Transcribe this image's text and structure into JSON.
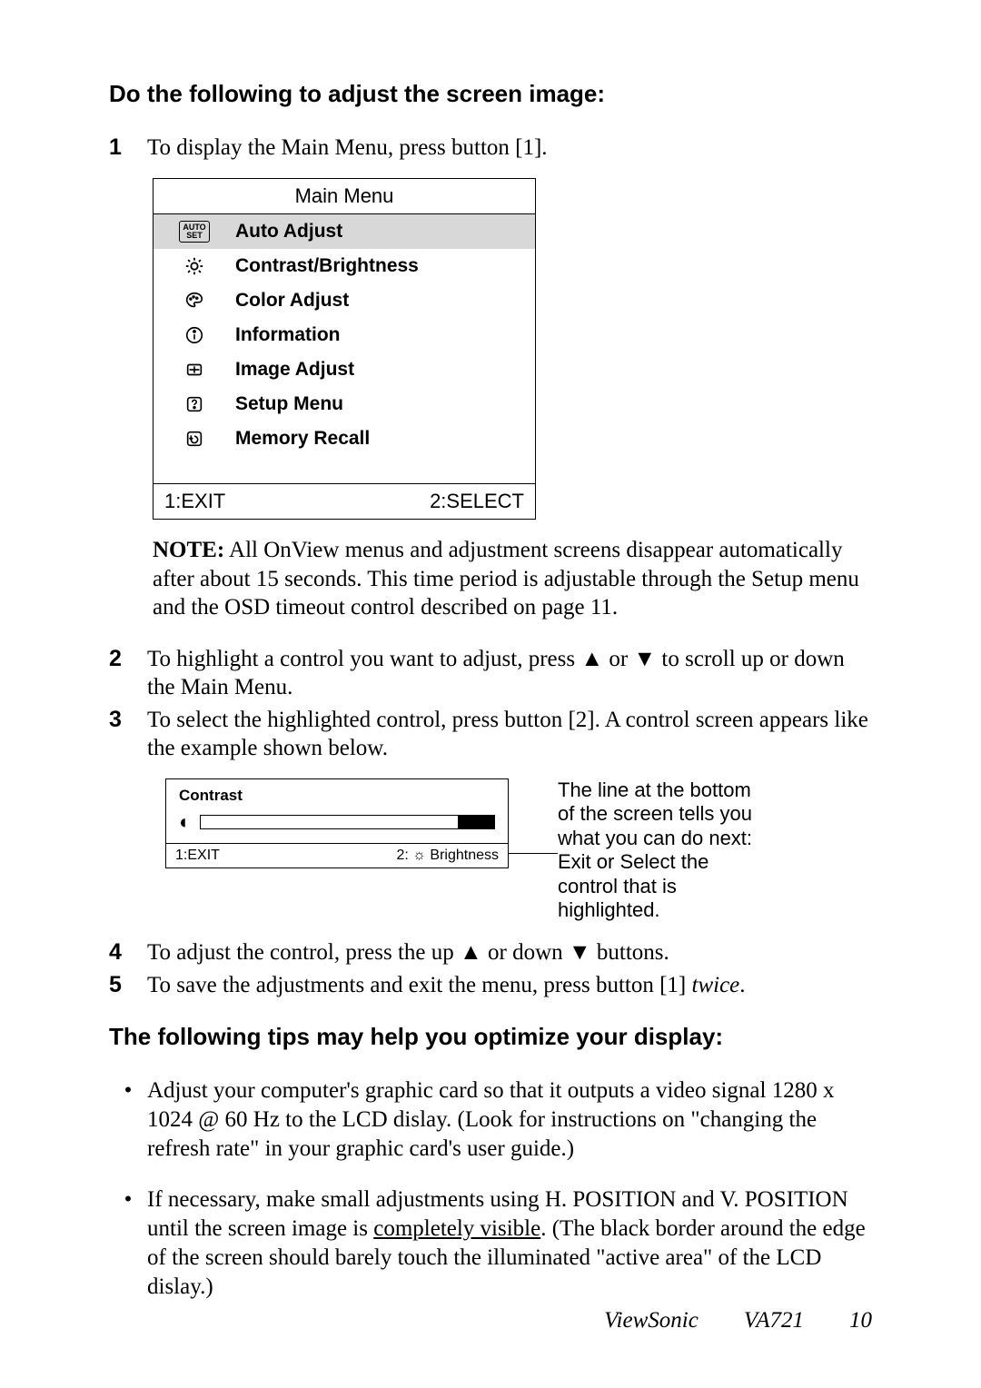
{
  "heading1": "Do the following to adjust the screen image:",
  "steps": {
    "s1": {
      "num": "1",
      "text": "To display the Main Menu, press button [1]."
    },
    "s2": {
      "num": "2",
      "text": "To highlight a control you want to adjust, press ▲ or ▼ to scroll up or down the Main Menu."
    },
    "s3": {
      "num": "3",
      "text": "To select the highlighted control, press button [2]. A control screen appears like the example shown below."
    },
    "s4": {
      "num": "4",
      "text": "To adjust the control, press the up ▲ or down ▼ buttons."
    },
    "s5": {
      "num": "5",
      "text_a": "To save the adjustments and exit the menu, press button [1] ",
      "text_b": "twice",
      "text_c": "."
    }
  },
  "menu": {
    "title": "Main Menu",
    "items": {
      "i0": "Auto Adjust",
      "i1": "Contrast/Brightness",
      "i2": "Color Adjust",
      "i3": "Information",
      "i4": "Image Adjust",
      "i5": "Setup Menu",
      "i6": "Memory Recall"
    },
    "autoset_top": "AUTO",
    "autoset_bot": "SET",
    "footer_left": "1:EXIT",
    "footer_right": "2:SELECT"
  },
  "note": {
    "label": "NOTE:",
    "text": " All OnView menus and adjustment screens disappear automatically after about 15 seconds. This time period is adjustable through the Setup menu and the OSD timeout control described on page 11."
  },
  "control_panel": {
    "label": "Contrast",
    "footer_left": "1:EXIT",
    "footer_right": "2: ☼ Brightness"
  },
  "callout": "The line at the bottom of the screen tells you what you can do next: Exit or Select the control that is highlighted.",
  "heading2": "The following tips may help you optimize your display:",
  "tips": {
    "t1": "Adjust your computer's graphic card so that it outputs a video signal 1280 x 1024 @ 60 Hz to the LCD dislay. (Look for instructions on \"changing the refresh rate\" in your graphic card's user guide.)",
    "t2_a": "If necessary, make small adjustments using H. POSITION and V. POSITION until the screen image is ",
    "t2_b": "completely visible",
    "t2_c": ". (The black border around the edge of the screen should barely touch the illuminated \"active area\" of the LCD dislay.)"
  },
  "footer": {
    "brand": "ViewSonic",
    "model": "VA721",
    "page": "10"
  }
}
